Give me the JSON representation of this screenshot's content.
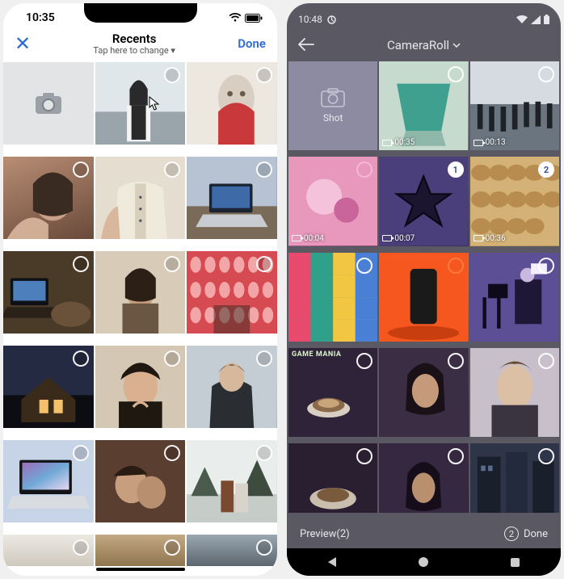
{
  "ios": {
    "status_time": "10:35",
    "close_glyph": "✕",
    "title": "Recents",
    "subtitle": "Tap here to change ▾",
    "done": "Done",
    "cells": [
      {
        "type": "camera"
      },
      {
        "type": "photo",
        "bg": "linear-gradient(180deg,#e6ecef 0%,#cdd6da 40%,#889099 100%)",
        "overlay": "girl"
      },
      {
        "type": "photo",
        "bg": "linear-gradient(135deg,#f3efe9,#d9d3c9)",
        "overlay": "statue"
      },
      {
        "type": "photo",
        "bg": "linear-gradient(160deg,#b88d74,#6a4a3a)",
        "overlay": "selfie"
      },
      {
        "type": "photo",
        "bg": "linear-gradient(180deg,#e9e1d5,#c9bda9)",
        "overlay": "shirt"
      },
      {
        "type": "photo",
        "bg": "linear-gradient(150deg,#a6b3c7,#5f6e84)",
        "overlay": "laptop1"
      },
      {
        "type": "photo",
        "bg": "linear-gradient(180deg,#6a4f33,#2a1f14)",
        "overlay": "laptop2"
      },
      {
        "type": "photo",
        "bg": "linear-gradient(180deg,#f1e7d9,#b79d7f)",
        "overlay": "portrait1"
      },
      {
        "type": "photo",
        "bg": "linear-gradient(170deg,#e5575f,#b0343c)",
        "overlay": "lanterns"
      },
      {
        "type": "photo",
        "bg": "linear-gradient(180deg,#2a2e44 0%,#0e1018 60%)",
        "overlay": "cabin"
      },
      {
        "type": "photo",
        "bg": "linear-gradient(180deg,#e7ddd1,#7e6a55)",
        "overlay": "portrait2"
      },
      {
        "type": "photo",
        "bg": "linear-gradient(180deg,#d3dbe0,#8b97a3)",
        "overlay": "hoodie"
      },
      {
        "type": "photo",
        "bg": "linear-gradient(140deg,#9fb2d4,#dbe3ef)",
        "overlay": "macbook"
      },
      {
        "type": "photo",
        "bg": "linear-gradient(160deg,#8a5a44,#3c2a20)",
        "overlay": "sleep"
      },
      {
        "type": "photo",
        "bg": "linear-gradient(180deg,#eef1f0,#b9c0bc)",
        "overlay": "couple"
      },
      {
        "type": "photo",
        "bg": "linear-gradient(180deg,#ece9e4,#cfc9bd)",
        "overlay": "",
        "partial": true
      },
      {
        "type": "photo",
        "bg": "linear-gradient(180deg,#c4a985,#8e744f)",
        "overlay": "",
        "partial": true
      },
      {
        "type": "photo",
        "bg": "linear-gradient(180deg,#9aa6b0,#5c6770)",
        "overlay": "",
        "partial": true
      }
    ]
  },
  "android": {
    "status_time": "10:48",
    "title": "CameraRoll",
    "shot_label": "Shot",
    "preview_label": "Preview(2)",
    "done_label": "Done",
    "done_count": "2",
    "cells": [
      {
        "type": "shot"
      },
      {
        "bg": "linear-gradient(155deg,#d8e6dc,#5aa091 55%,#2d5c53)",
        "video": "00:35",
        "overlay": "pool"
      },
      {
        "bg": "linear-gradient(180deg,#cfd6df,#6d7884)",
        "video": "00:13",
        "overlay": "crowd"
      },
      {
        "bg": "linear-gradient(160deg,#fbb7d5,#b44f86 60%,#5a2549)",
        "video": "00:04",
        "overlay": "pink",
        "selStyle": "pink"
      },
      {
        "bg": "linear-gradient(155deg,#6f63a6,#2f2750)",
        "video": "00:07",
        "overlay": "star",
        "selected": "1"
      },
      {
        "bg": "linear-gradient(150deg,#e9c98f,#a77b3f)",
        "video": "00:36",
        "overlay": "nuts",
        "selected": "2"
      },
      {
        "bg": "linear-gradient(120deg,#e84a6d,#2fa08a 50%,#f2c641)",
        "overlay": "shelves"
      },
      {
        "bg": "linear-gradient(180deg,#ff6a2f,#e43f12)",
        "overlay": "phone",
        "selStyle": "orange"
      },
      {
        "bg": "linear-gradient(170deg,#7f6fc0,#3a2f6b)",
        "overlay": "camera-man"
      },
      {
        "bg": "linear-gradient(170deg,#3e2f4d,#1a1322)",
        "overlay": "coffee",
        "text": "GAME MANIA"
      },
      {
        "bg": "linear-gradient(175deg,#53435c,#1f1825)",
        "overlay": "woman1"
      },
      {
        "bg": "linear-gradient(175deg,#d7d0d9,#8e8496)",
        "overlay": "man1"
      },
      {
        "bg": "linear-gradient(175deg,#3c2f42,#17111c)",
        "overlay": "coffee2",
        "partial": true
      },
      {
        "bg": "linear-gradient(175deg,#4a3a53,#1c1523)",
        "overlay": "woman2",
        "partial": true
      },
      {
        "bg": "linear-gradient(175deg,#3f4a63,#171c28)",
        "overlay": "street",
        "partial": true
      }
    ]
  }
}
